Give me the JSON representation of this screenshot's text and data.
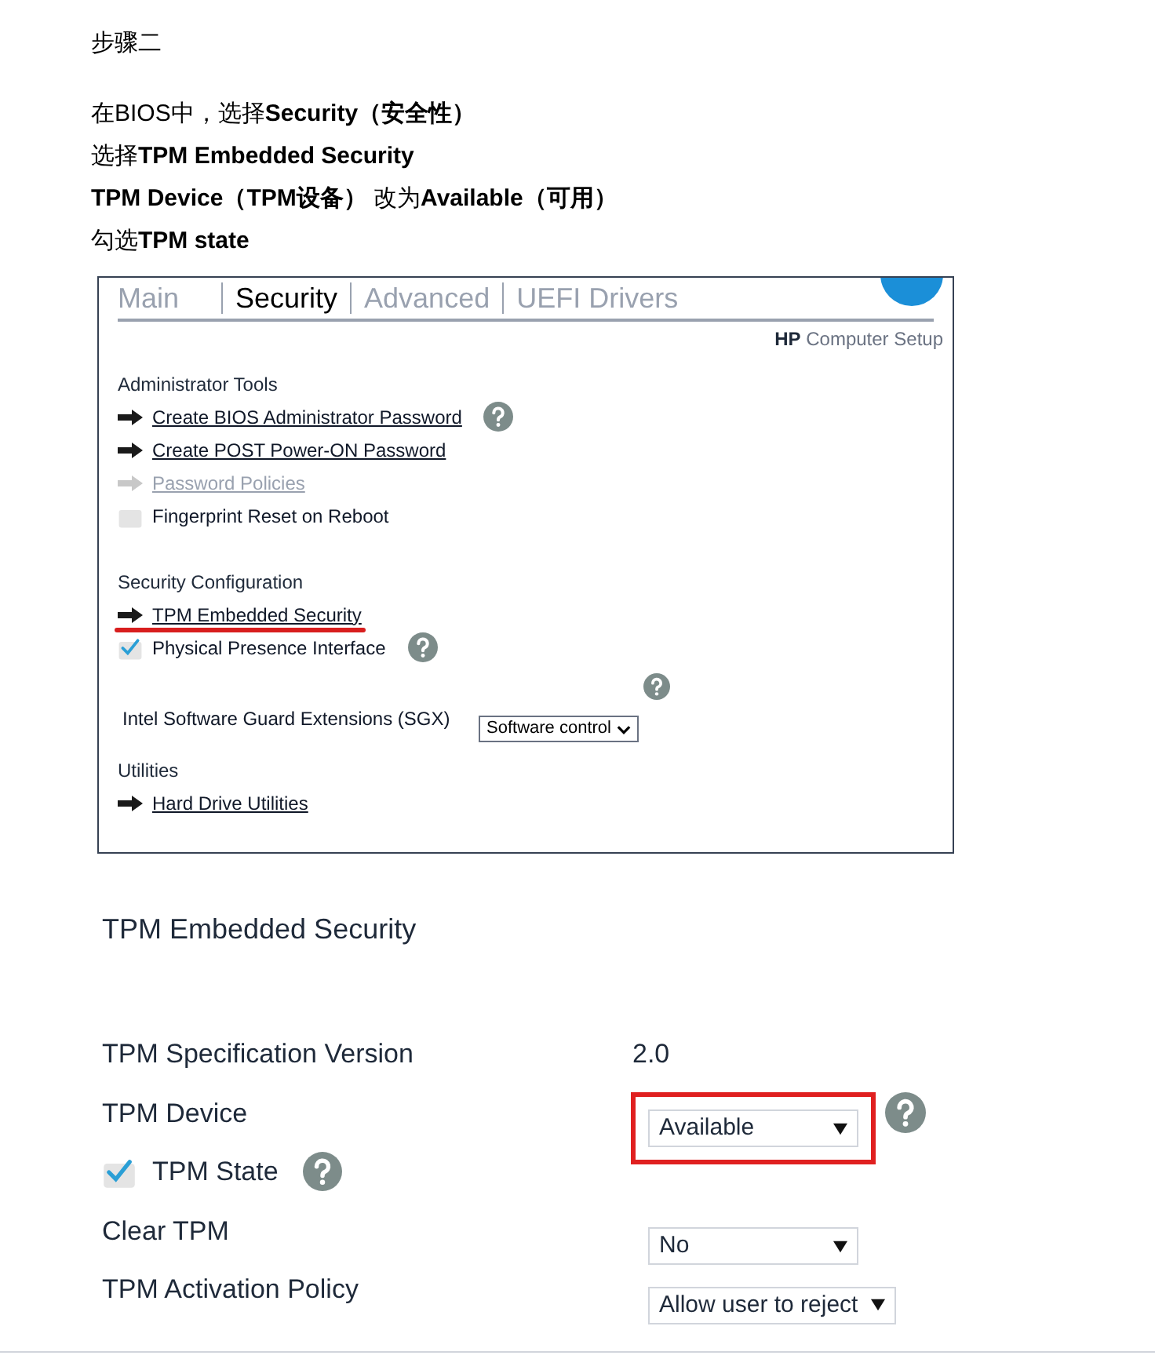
{
  "heading": "步骤二",
  "instructions": [
    "在BIOS中，选择**Security（安全性）**",
    "选择**TPM Embedded Security**",
    "**TPM Device（TPM设备）** 改为**Available（可用）**",
    "勾选**TPM state**"
  ],
  "bios_menu": {
    "tabs": [
      {
        "label": "Main",
        "selected": false
      },
      {
        "label": "Security",
        "selected": true
      },
      {
        "label": "Advanced",
        "selected": false
      },
      {
        "label": "UEFI Drivers",
        "selected": false
      }
    ],
    "brand": "**HP** Computer Setup",
    "sections": [
      {
        "title": "Administrator Tools",
        "items": [
          {
            "kind": "link",
            "label": "Create BIOS Administrator Password",
            "disabled": false,
            "help": true
          },
          {
            "kind": "link",
            "label": "Create POST Power-ON Password",
            "disabled": false,
            "help": false
          },
          {
            "kind": "link",
            "label": "Password Policies",
            "disabled": true,
            "help": false
          },
          {
            "kind": "checkbox",
            "label": "Fingerprint Reset on Reboot",
            "checked": false,
            "help": false
          }
        ]
      },
      {
        "title": "Security Configuration",
        "items": [
          {
            "kind": "link",
            "label": "TPM Embedded Security",
            "disabled": false,
            "help": false,
            "annotated": true
          },
          {
            "kind": "checkbox",
            "label": "Physical Presence Interface",
            "checked": true,
            "help": true
          },
          {
            "kind": "select",
            "label": "Intel Software Guard Extensions (SGX)",
            "value": "Software control",
            "help": true
          }
        ]
      },
      {
        "title": "Utilities",
        "items": [
          {
            "kind": "link",
            "label": "Hard Drive Utilities",
            "disabled": false,
            "help": false
          }
        ]
      }
    ]
  },
  "tpm_screen": {
    "title": "TPM Embedded Security",
    "rows": [
      {
        "kind": "value",
        "label": "TPM Specification Version",
        "value": "2.0"
      },
      {
        "kind": "select",
        "label": "TPM Device",
        "value": "Available",
        "highlighted": true,
        "help": true
      },
      {
        "kind": "checkbox",
        "label": "TPM State",
        "checked": true,
        "help": true
      },
      {
        "kind": "select",
        "label": "Clear TPM",
        "value": "No",
        "highlighted": false,
        "help": false
      },
      {
        "kind": "select",
        "label": "TPM Activation Policy",
        "value": "Allow user to reject",
        "highlighted": false,
        "help": false
      }
    ]
  }
}
